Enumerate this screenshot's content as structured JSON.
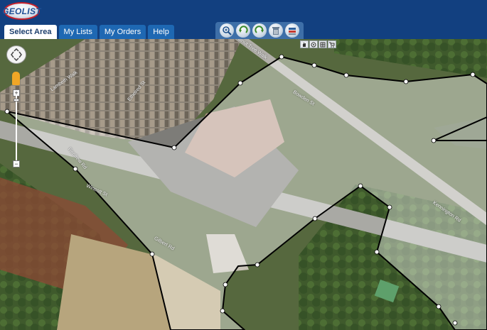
{
  "app": {
    "logo_text": "GEOLIST"
  },
  "tabs": [
    {
      "label": "Select Area",
      "active": true
    },
    {
      "label": "My Lists",
      "active": false
    },
    {
      "label": "My Orders",
      "active": false
    },
    {
      "label": "Help",
      "active": false
    }
  ],
  "toolbar": {
    "tools": [
      "zoom-icon",
      "undo-icon",
      "redo-icon",
      "delete-icon",
      "stack-icon"
    ]
  },
  "map_controls": {
    "mini_tools": [
      "hand-icon",
      "target-icon",
      "grid-icon",
      "cart-icon"
    ],
    "zoom_in_label": "+",
    "zoom_out_label": "−"
  },
  "street_labels": [
    "Lambeth Walk",
    "Ethelred St",
    "Wincott St",
    "Gilbert Rd",
    "Walnut Tree Walk",
    "Kennington Rd",
    "Bowden St",
    "Renfrew Rd"
  ],
  "colors": {
    "header": "#124080",
    "tab": "#1e68b3",
    "selection_fill": "#ffffff",
    "selection_stroke": "#000000"
  }
}
